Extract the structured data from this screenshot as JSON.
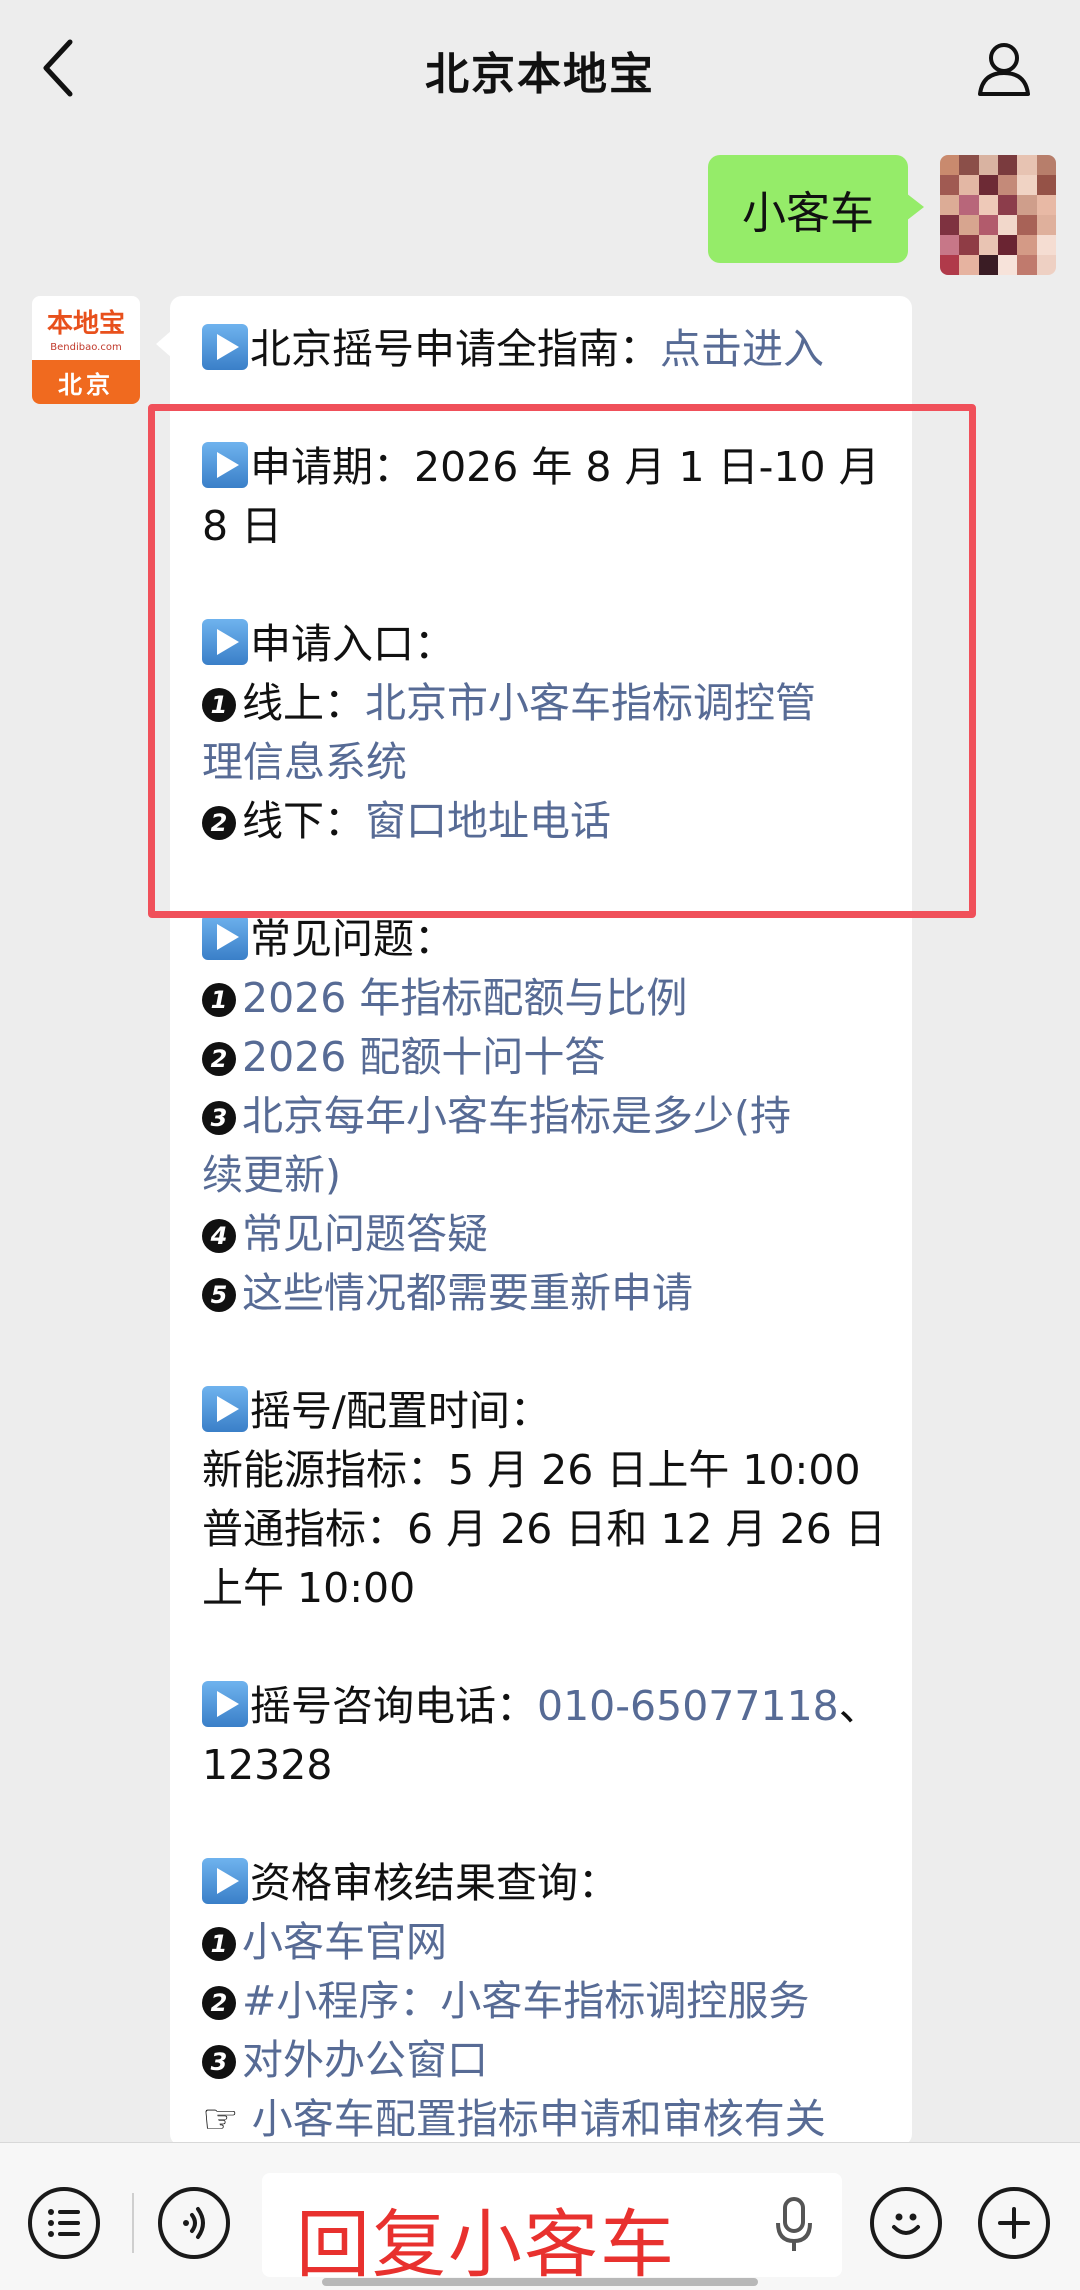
{
  "header": {
    "title": "北京本地宝",
    "back_icon": "back-chevron-icon",
    "profile_icon": "person-icon"
  },
  "sent": {
    "text": "小客车"
  },
  "bot_avatar": {
    "brand": "本地宝",
    "domain": "Bendibao.com",
    "city": "北京"
  },
  "message": {
    "guide_label": "北京摇号申请全指南：",
    "guide_link": "点击进入",
    "period_line1": "申请期：2026 年 8 月 1 日-10 月",
    "period_line2": "8 日",
    "entry_label": "申请入口：",
    "online_label": "线上：",
    "online_link_1": "北京市小客车指标调控管",
    "online_link_2": "理信息系统",
    "offline_label": "线下：",
    "offline_link": "窗口地址电话",
    "faq_label": "常见问题：",
    "faq_1": "2026 年指标配额与比例",
    "faq_2": "2026 配额十问十答",
    "faq_3a": "北京每年小客车指标是多少(持",
    "faq_3b": "续更新)",
    "faq_4": "常见问题答疑",
    "faq_5": "这些情况都需要重新申请",
    "lottery_label": "摇号/配置时间：",
    "lottery_1": "新能源指标：5 月 26 日上午 10:00",
    "lottery_2": "普通指标：6 月 26 日和 12 月 26 日",
    "lottery_3": "上午 10:00",
    "phone_label": "摇号咨询电话：",
    "phone_link": "010-65077118",
    "phone_sep": "、",
    "phone_2": "12328",
    "qual_label": "资格审核结果查询：",
    "qual_1": "小客车官网",
    "qual_2": "#小程序：小客车指标调控服务",
    "qual_3": "对外办公窗口",
    "qual_4": "小客车配置指标申请和审核有关"
  },
  "bottom_bar": {
    "input_text": "回复小客车",
    "menu_icon": "list-menu-icon",
    "voice_icon": "voice-icon",
    "mic_icon": "microphone-icon",
    "emoji_icon": "emoji-icon",
    "plus_icon": "plus-icon"
  }
}
